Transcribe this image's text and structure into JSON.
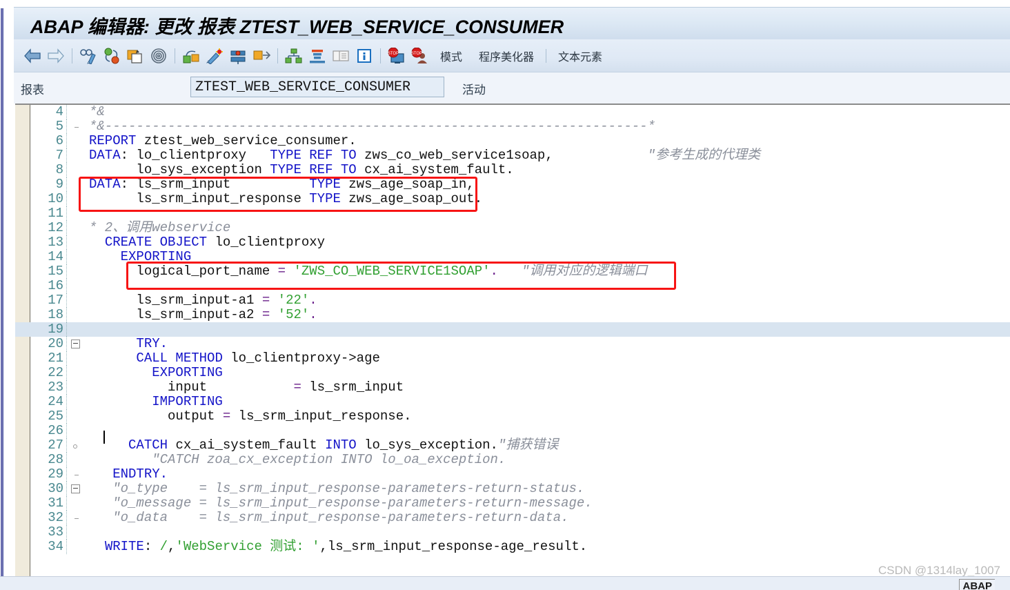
{
  "window": {
    "title": "ABAP 编辑器: 更改 报表 ZTEST_WEB_SERVICE_CONSUMER"
  },
  "toolbar": {
    "icons": [
      {
        "name": "back-arrow-icon",
        "label": "返回"
      },
      {
        "name": "forward-arrow-icon",
        "label": "前进"
      },
      {
        "name": "display-change-icon",
        "label": "显示/更改"
      },
      {
        "name": "activate-icon",
        "label": "激活"
      },
      {
        "name": "check-icon",
        "label": "检查"
      },
      {
        "name": "where-used-icon",
        "label": "使用位置"
      },
      {
        "name": "pattern-icon",
        "label": "模式"
      },
      {
        "name": "pretty-printer-icon",
        "label": "美化器"
      },
      {
        "name": "debug-icon",
        "label": "调试"
      },
      {
        "name": "navigate-icon",
        "label": "导航"
      },
      {
        "name": "hierarchy-icon",
        "label": "层次"
      },
      {
        "name": "stack-icon",
        "label": "堆栈"
      },
      {
        "name": "list-icon",
        "label": "列表"
      },
      {
        "name": "info-icon",
        "label": "信息"
      },
      {
        "name": "breakpoint-session-icon",
        "label": "会话断点"
      },
      {
        "name": "breakpoint-user-icon",
        "label": "用户断点"
      }
    ],
    "text_buttons": [
      "模式",
      "程序美化器",
      "文本元素"
    ]
  },
  "subheader": {
    "label": "报表",
    "name_value": "ZTEST_WEB_SERVICE_CONSUMER",
    "name_placeholder": "ZTEST_WEB_SERVICE_CONSUMER",
    "status": "活动"
  },
  "editor": {
    "current_line": 19,
    "lines": [
      {
        "n": 4,
        "fold": "end-top",
        "html": "<span class='cmt'>*&amp;</span>"
      },
      {
        "n": 5,
        "fold": "end-bot",
        "html": "<span class='cmt'>*&amp;---------------------------------------------------------------------*</span>"
      },
      {
        "n": 6,
        "fold": "none",
        "html": "<span class='kw'>REPORT</span> <span class='pl'>ztest_web_service_consumer.</span>"
      },
      {
        "n": 7,
        "fold": "none",
        "html": "<span class='kw'>DATA</span><span class='pl'>:</span> <span class='pl'>lo_clientproxy   </span><span class='kw'>TYPE REF TO</span> <span class='pl'>zws_co_web_service1soap,</span>            <span class='cmt'>\"参考生成的代理类</span>"
      },
      {
        "n": 8,
        "fold": "none",
        "html": "<span class='pl'>      lo_sys_exception </span><span class='kw'>TYPE REF TO</span> <span class='pl'>cx_ai_system_fault.</span>"
      },
      {
        "n": 9,
        "fold": "none",
        "html": "<span class='kw'>DATA</span><span class='pl'>:</span> <span class='pl'>ls_srm_input          </span><span class='kw'>TYPE</span> <span class='pl'>zws_age_soap_in,</span>"
      },
      {
        "n": 10,
        "fold": "none",
        "html": "<span class='pl'>      ls_srm_input_response </span><span class='kw'>TYPE</span> <span class='pl'>zws_age_soap_out.</span>"
      },
      {
        "n": 11,
        "fold": "none",
        "html": ""
      },
      {
        "n": 12,
        "fold": "none",
        "html": "<span class='cmt'>* 2、调用webservice</span>"
      },
      {
        "n": 13,
        "fold": "none",
        "html": "  <span class='kw'>CREATE OBJECT</span> <span class='pl'>lo_clientproxy</span>"
      },
      {
        "n": 14,
        "fold": "none",
        "html": "    <span class='kw'>EXPORTING</span>"
      },
      {
        "n": 15,
        "fold": "none",
        "html": "      <span class='pl'>logical_port_name</span> <span class='op'>=</span> <span class='str'>'ZWS_CO_WEB_SERVICE1SOAP'</span><span class='op'>.</span>   <span class='cmt'>\"调用对应的逻辑端口</span>"
      },
      {
        "n": 16,
        "fold": "none",
        "html": ""
      },
      {
        "n": 17,
        "fold": "none",
        "html": "      <span class='pl'>ls_srm_input-a1</span> <span class='op'>=</span> <span class='str'>'22'</span><span class='op'>.</span>"
      },
      {
        "n": 18,
        "fold": "none",
        "html": "      <span class='pl'>ls_srm_input-a2</span> <span class='op'>=</span> <span class='str'>'52'</span><span class='op'>.</span>"
      },
      {
        "n": 19,
        "fold": "none",
        "html": ""
      },
      {
        "n": 20,
        "fold": "box",
        "html": "      <span class='kw'>TRY.</span>"
      },
      {
        "n": 21,
        "fold": "bar",
        "html": "      <span class='kw'>CALL METHOD</span> <span class='pl'>lo_clientproxy-&gt;age</span>"
      },
      {
        "n": 22,
        "fold": "bar",
        "html": "        <span class='kw'>EXPORTING</span>"
      },
      {
        "n": 23,
        "fold": "bar",
        "html": "          <span class='pl'>input          </span> <span class='op'>=</span> <span class='pl'>ls_srm_input</span>"
      },
      {
        "n": 24,
        "fold": "bar",
        "html": "        <span class='kw'>IMPORTING</span>"
      },
      {
        "n": 25,
        "fold": "bar",
        "html": "          <span class='pl'>output</span> <span class='op'>=</span> <span class='pl'>ls_srm_input_response.</span>"
      },
      {
        "n": 26,
        "fold": "bar",
        "html": ""
      },
      {
        "n": 27,
        "fold": "dot",
        "html": "     <span class='kw'>CATCH</span> <span class='pl'>cx_ai_system_fault</span> <span class='kw'>INTO</span> <span class='pl'>lo_sys_exception.</span><span class='cmt'>\"捕获错误</span>"
      },
      {
        "n": 28,
        "fold": "bar",
        "html": "        <span class='cmt'>\"CATCH zoa_cx_exception INTO lo_oa_exception.</span>"
      },
      {
        "n": 29,
        "fold": "end-bot",
        "html": "   <span class='kw'>ENDTRY.</span>"
      },
      {
        "n": 30,
        "fold": "box",
        "html": "   <span class='cmt'>\"o_type    = ls_srm_input_response-parameters-return-status.</span>"
      },
      {
        "n": 31,
        "fold": "bar",
        "html": "   <span class='cmt'>\"o_message = ls_srm_input_response-parameters-return-message.</span>"
      },
      {
        "n": 32,
        "fold": "end-bot",
        "html": "   <span class='cmt'>\"o_data    = ls_srm_input_response-parameters-return-data.</span>"
      },
      {
        "n": 33,
        "fold": "none",
        "html": ""
      },
      {
        "n": 34,
        "fold": "none",
        "html": "  <span class='kw'>WRITE</span><span class='pl'>:</span> <span class='str'>/</span><span class='pl'>,</span><span class='str'>'WebService 测试: '</span><span class='pl'>,ls_srm_input_response-age_result.</span>"
      }
    ]
  },
  "annotations": {
    "box1_label": "highlight-data-declaration",
    "box2_label": "highlight-logical-port-name",
    "box_color": "#f71414"
  },
  "footer": {
    "watermark": "CSDN @1314lay_1007",
    "tab_label": "ABAP"
  }
}
